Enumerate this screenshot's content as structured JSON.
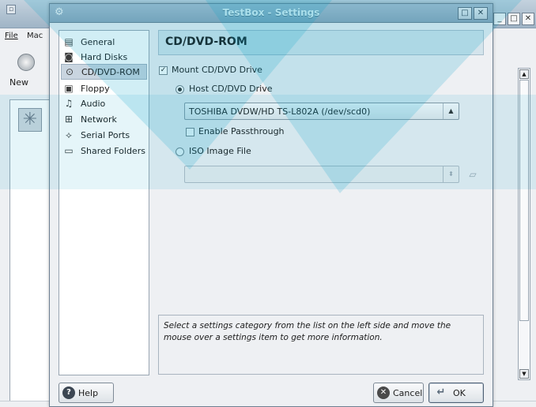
{
  "background_window": {
    "menu": {
      "file": "File",
      "machine": "Mac"
    },
    "toolbar": {
      "new_label": "New"
    }
  },
  "dialog": {
    "title": "TestBox - Settings",
    "title_buttons": [
      "□",
      "✕"
    ],
    "categories": [
      {
        "label": "General",
        "icon": "general-icon"
      },
      {
        "label": "Hard Disks",
        "icon": "hard-disk-icon"
      },
      {
        "label": "CD/DVD-ROM",
        "icon": "cd-icon",
        "selected": true
      },
      {
        "label": "Floppy",
        "icon": "floppy-icon"
      },
      {
        "label": "Audio",
        "icon": "audio-icon"
      },
      {
        "label": "Network",
        "icon": "network-icon"
      },
      {
        "label": "Serial Ports",
        "icon": "serial-port-icon"
      },
      {
        "label": "Shared Folders",
        "icon": "shared-folder-icon"
      }
    ],
    "page": {
      "title": "CD/DVD-ROM",
      "mount_checkbox": {
        "label": "Mount CD/DVD Drive",
        "checked": true
      },
      "host_drive_radio": {
        "label": "Host CD/DVD Drive",
        "selected": true
      },
      "host_drive_combo": {
        "value": "TOSHIBA DVDW/HD TS-L802A (/dev/scd0)"
      },
      "passthrough_checkbox": {
        "label": "Enable Passthrough",
        "checked": false
      },
      "iso_radio": {
        "label": "ISO Image File",
        "selected": false
      },
      "iso_combo": {
        "value": ""
      }
    },
    "info_text": "Select a settings category from the list on the left side and move the mouse over a settings item to get more information.",
    "buttons": {
      "help": "Help",
      "cancel": "Cancel",
      "ok": "OK"
    }
  },
  "colors": {
    "title_bar": "#8ea6ba",
    "header_bg": "#d4e4ec",
    "selection_bg": "#c9d5e0",
    "overlay_blue": "#00a0c8"
  }
}
